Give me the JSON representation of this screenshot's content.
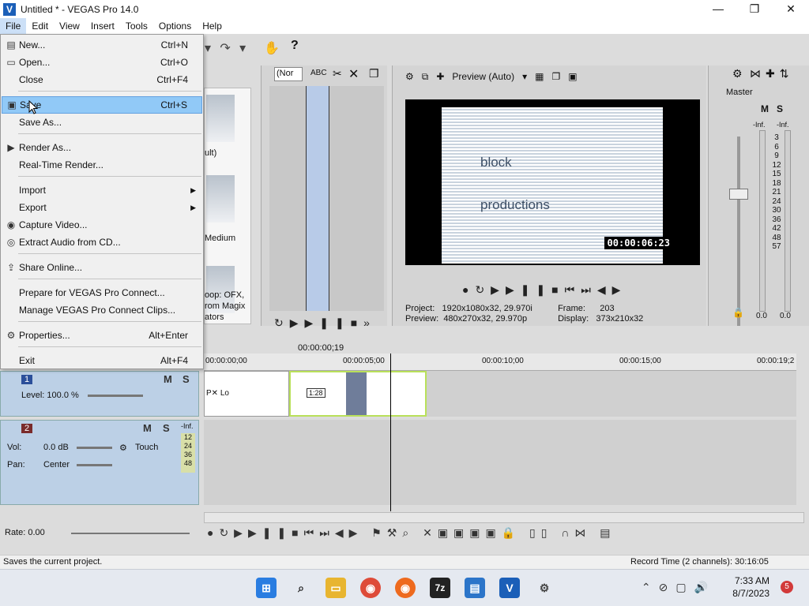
{
  "window": {
    "title": "Untitled * - VEGAS Pro 14.0",
    "app_icon": "vegas-logo-icon",
    "minimize": "—",
    "maximize": "❐",
    "close": "✕"
  },
  "menubar": [
    "File",
    "Edit",
    "View",
    "Insert",
    "Tools",
    "Options",
    "Help"
  ],
  "file_menu": {
    "items": [
      {
        "label": "New...",
        "shortcut": "Ctrl+N",
        "icon": "new-file-icon"
      },
      {
        "label": "Open...",
        "shortcut": "Ctrl+O",
        "icon": "open-folder-icon"
      },
      {
        "label": "Close",
        "shortcut": "Ctrl+F4",
        "icon": ""
      },
      {
        "label": "Save",
        "shortcut": "Ctrl+S",
        "icon": "save-icon",
        "highlighted": true
      },
      {
        "label": "Save As...",
        "shortcut": "",
        "icon": ""
      },
      {
        "label": "Render As...",
        "shortcut": "",
        "icon": "render-icon"
      },
      {
        "label": "Real-Time Render...",
        "shortcut": "",
        "icon": ""
      },
      {
        "label": "Import",
        "shortcut": "",
        "icon": "",
        "submenu": true
      },
      {
        "label": "Export",
        "shortcut": "",
        "icon": "",
        "submenu": true
      },
      {
        "label": "Capture Video...",
        "shortcut": "",
        "icon": "capture-icon"
      },
      {
        "label": "Extract Audio from CD...",
        "shortcut": "",
        "icon": "cd-icon"
      },
      {
        "label": "Share Online...",
        "shortcut": "",
        "icon": "share-icon"
      },
      {
        "label": "Prepare for VEGAS Pro Connect...",
        "shortcut": "",
        "icon": ""
      },
      {
        "label": "Manage VEGAS Pro Connect Clips...",
        "shortcut": "",
        "icon": ""
      },
      {
        "label": "Properties...",
        "shortcut": "Alt+Enter",
        "icon": "gear-icon"
      },
      {
        "label": "Exit",
        "shortcut": "Alt+F4",
        "icon": ""
      }
    ]
  },
  "media_panel": {
    "text1": "ult)",
    "text2": "Medium",
    "text3": "oop: OFX,",
    "text4": "rom Magix",
    "text5": "ators"
  },
  "trimmer": {
    "select_value": "(Nor",
    "timecode": "00:00:00;19"
  },
  "preview": {
    "mode": "Preview (Auto)",
    "video_text1": "block",
    "video_text2": "productions",
    "overlay_timecode": "00:00:06:23",
    "project_label": "Project:",
    "project_value": "1920x1080x32, 29.970i",
    "preview_label": "Preview:",
    "preview_value": "480x270x32, 29.970p",
    "frame_label": "Frame:",
    "frame_value": "203",
    "display_label": "Display:",
    "display_value": "373x210x32"
  },
  "mixer": {
    "master": "Master",
    "m_label": "M",
    "s_label": "S",
    "inf_left": "-Inf.",
    "inf_right": "-Inf.",
    "ticks": [
      "3",
      "6",
      "9",
      "12",
      "15",
      "18",
      "21",
      "24",
      "30",
      "36",
      "42",
      "48",
      "57"
    ],
    "bottom_left": "0.0",
    "bottom_right": "0.0"
  },
  "timeline": {
    "ruler": [
      "00:00:00;00",
      "00:00:05;00",
      "00:00:10;00",
      "00:00:15;00",
      "00:00:19;2"
    ],
    "track1": {
      "number": "1",
      "level_label": "Level: 100.0 %",
      "m": "M",
      "s": "S"
    },
    "track2": {
      "number": "2",
      "vol_label": "Vol:",
      "vol_value": "0.0 dB",
      "pan_label": "Pan:",
      "pan_value": "Center",
      "mode": "Touch",
      "m": "M",
      "s": "S",
      "inf": "-Inf.",
      "meter_ticks": [
        "12",
        "24",
        "36",
        "48"
      ]
    },
    "clip_label": "1:28",
    "clip_text": "P✕ Lo"
  },
  "bottom": {
    "rate": "Rate: 0.00"
  },
  "status": {
    "left": "Saves the current project.",
    "right": "Record Time (2 channels): 30:16:05"
  },
  "taskbar": {
    "time": "7:33 AM",
    "date": "8/7/2023",
    "badge": "5"
  }
}
